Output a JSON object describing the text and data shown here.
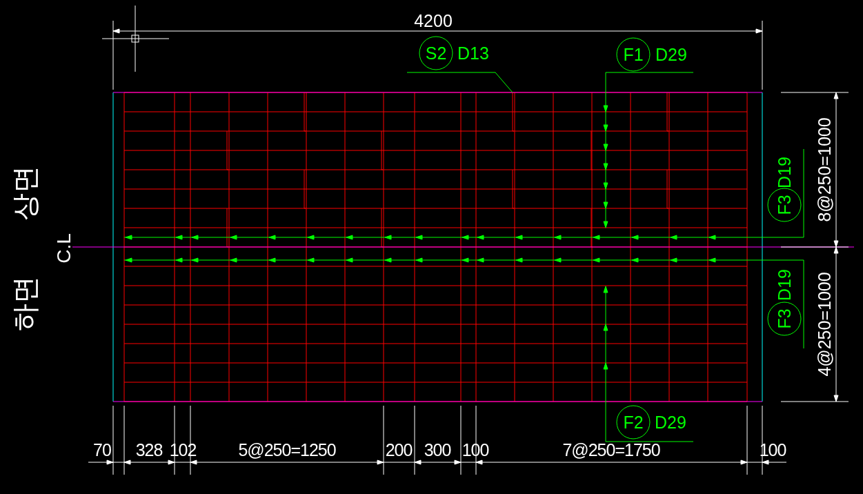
{
  "top_dimension": {
    "text": "4200"
  },
  "bar_marks": [
    {
      "mark": "S2",
      "size": "D13"
    },
    {
      "mark": "F1",
      "size": "D29"
    },
    {
      "mark": "F2",
      "size": "D29"
    },
    {
      "mark": "F3",
      "size": "D19"
    },
    {
      "mark": "F3",
      "size": "D19"
    }
  ],
  "bottom_dimensions": [
    {
      "text": "70"
    },
    {
      "text": "328"
    },
    {
      "text": "102"
    },
    {
      "text": "5@250=1250"
    },
    {
      "text": "200"
    },
    {
      "text": "300"
    },
    {
      "text": "100"
    },
    {
      "text": "7@250=1750"
    },
    {
      "text": "100"
    }
  ],
  "right_dimensions": [
    {
      "text": "8@250=1000"
    },
    {
      "text": "4@250=1000"
    }
  ],
  "side_labels": [
    {
      "text": "상면"
    },
    {
      "text": "하면"
    }
  ],
  "centerline_label": "C.L"
}
